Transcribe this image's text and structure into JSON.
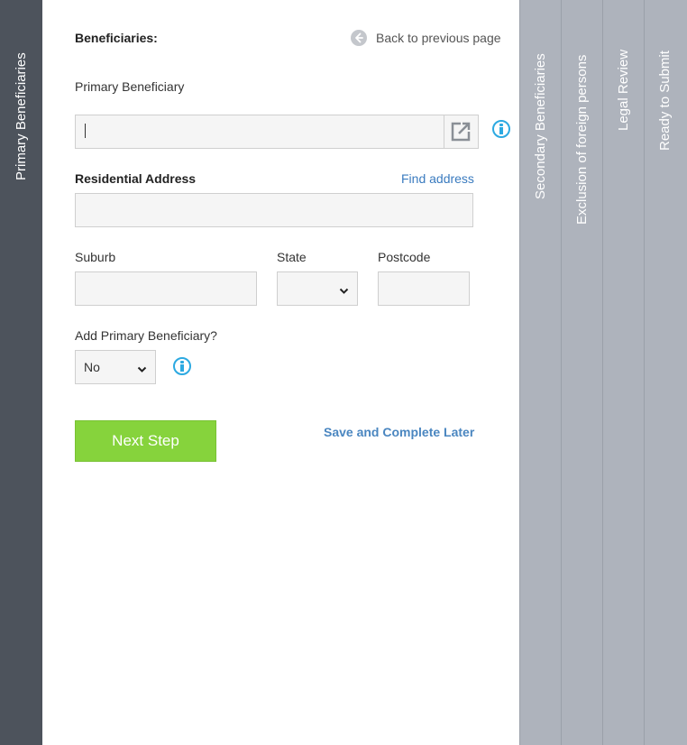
{
  "left_tab": {
    "label": "Primary Beneficiaries"
  },
  "right_tabs": [
    {
      "label": "Secondary Beneficiaries"
    },
    {
      "label": "Exclusion of foreign persons"
    },
    {
      "label": "Legal Review"
    },
    {
      "label": "Ready to Submit"
    }
  ],
  "header": {
    "title": "Beneficiaries:",
    "back_label": "Back to previous page"
  },
  "form": {
    "primary_beneficiary_label": "Primary Beneficiary",
    "primary_beneficiary_value": "",
    "residential_address_label": "Residential Address",
    "find_address_label": "Find address",
    "address_value": "",
    "suburb_label": "Suburb",
    "suburb_value": "",
    "state_label": "State",
    "state_value": "",
    "postcode_label": "Postcode",
    "postcode_value": "",
    "add_primary_label": "Add Primary Beneficiary?",
    "add_primary_value": "No"
  },
  "actions": {
    "next_step_label": "Next Step",
    "save_later_label": "Save and Complete Later"
  },
  "colors": {
    "left_tab_bg": "#4d535c",
    "right_tab_bg": "#aeb3bc",
    "accent_green": "#86d33c",
    "link_blue": "#3a7bbf",
    "info_blue": "#2ca9e1"
  }
}
